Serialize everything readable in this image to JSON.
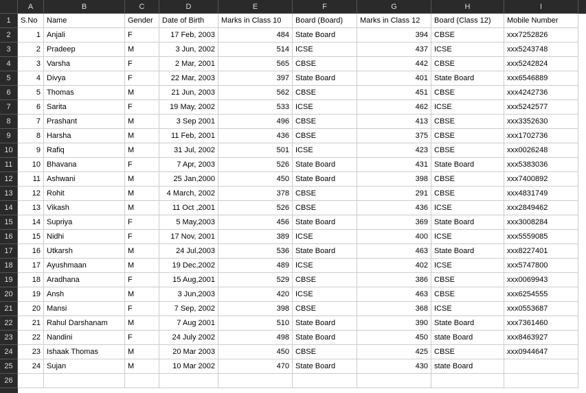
{
  "columns": [
    "A",
    "B",
    "C",
    "D",
    "E",
    "F",
    "G",
    "H",
    "I"
  ],
  "row_numbers": [
    1,
    2,
    3,
    4,
    5,
    6,
    7,
    8,
    9,
    10,
    11,
    12,
    13,
    14,
    15,
    16,
    17,
    18,
    19,
    20,
    21,
    22,
    23,
    24,
    25,
    26
  ],
  "headers": {
    "A": "S.No",
    "B": "Name",
    "C": "Gender",
    "D": "Date of Birth",
    "E": "Marks in Class 10",
    "F": "Board (Board)",
    "G": "Marks in Class 12",
    "H": "Board (Class 12)",
    "I": "Mobile Number"
  },
  "rows": [
    {
      "sno": 1,
      "name": "Anjali",
      "gender": "F",
      "dob": "17 Feb, 2003",
      "m10": 484,
      "b10": "State Board",
      "m12": 394,
      "b12": "CBSE",
      "mobile": "xxx7252826"
    },
    {
      "sno": 2,
      "name": "Pradeep",
      "gender": "M",
      "dob": "3 Jun, 2002",
      "m10": 514,
      "b10": "ICSE",
      "m12": 437,
      "b12": "ICSE",
      "mobile": "xxx5243748"
    },
    {
      "sno": 3,
      "name": "Varsha",
      "gender": "F",
      "dob": "2 Mar, 2001",
      "m10": 565,
      "b10": "CBSE",
      "m12": 442,
      "b12": "CBSE",
      "mobile": "xxx5242824"
    },
    {
      "sno": 4,
      "name": "Divya",
      "gender": "F",
      "dob": "22 Mar, 2003",
      "m10": 397,
      "b10": "State Board",
      "m12": 401,
      "b12": "State Board",
      "mobile": "xxx6546889"
    },
    {
      "sno": 5,
      "name": "Thomas",
      "gender": "M",
      "dob": "21 Jun, 2003",
      "m10": 562,
      "b10": "CBSE",
      "m12": 451,
      "b12": "CBSE",
      "mobile": "xxx4242736"
    },
    {
      "sno": 6,
      "name": "Sarita",
      "gender": "F",
      "dob": "19 May, 2002",
      "m10": 533,
      "b10": "ICSE",
      "m12": 462,
      "b12": "ICSE",
      "mobile": "xxx5242577"
    },
    {
      "sno": 7,
      "name": "Prashant",
      "gender": "M",
      "dob": "3 Sep 2001",
      "m10": 496,
      "b10": "CBSE",
      "m12": 413,
      "b12": "CBSE",
      "mobile": "xxx3352630"
    },
    {
      "sno": 8,
      "name": "Harsha",
      "gender": "M",
      "dob": "11 Feb, 2001",
      "m10": 436,
      "b10": "CBSE",
      "m12": 375,
      "b12": "CBSE",
      "mobile": "xxx1702736"
    },
    {
      "sno": 9,
      "name": "Rafiq",
      "gender": "M",
      "dob": "31 Jul, 2002",
      "m10": 501,
      "b10": "ICSE",
      "m12": 423,
      "b12": "CBSE",
      "mobile": "xxx0026248"
    },
    {
      "sno": 10,
      "name": "Bhavana",
      "gender": "F",
      "dob": "7 Apr, 2003",
      "m10": 526,
      "b10": "State Board",
      "m12": 431,
      "b12": "State Board",
      "mobile": "xxx5383036"
    },
    {
      "sno": 11,
      "name": "Ashwani",
      "gender": "M",
      "dob": "25 Jan,2000",
      "m10": 450,
      "b10": "State Board",
      "m12": 398,
      "b12": "CBSE",
      "mobile": "xxx7400892"
    },
    {
      "sno": 12,
      "name": "Rohit",
      "gender": "M",
      "dob": "4 March, 2002",
      "m10": 378,
      "b10": "CBSE",
      "m12": 291,
      "b12": "CBSE",
      "mobile": "xxx4831749"
    },
    {
      "sno": 13,
      "name": "Vikash",
      "gender": "M",
      "dob": "11 Oct ,2001",
      "m10": 526,
      "b10": "CBSE",
      "m12": 436,
      "b12": "ICSE",
      "mobile": "xxx2849462"
    },
    {
      "sno": 14,
      "name": "Supriya",
      "gender": "F",
      "dob": "5 May,2003",
      "m10": 456,
      "b10": "State Board",
      "m12": 369,
      "b12": "State Board",
      "mobile": "xxx3008284"
    },
    {
      "sno": 15,
      "name": "Nidhi",
      "gender": "F",
      "dob": "17 Nov, 2001",
      "m10": 389,
      "b10": "ICSE",
      "m12": 400,
      "b12": "ICSE",
      "mobile": "xxx5559085"
    },
    {
      "sno": 16,
      "name": "Utkarsh",
      "gender": "M",
      "dob": "24 Jul,2003",
      "m10": 536,
      "b10": "State Board",
      "m12": 463,
      "b12": "State Board",
      "mobile": "xxx8227401"
    },
    {
      "sno": 17,
      "name": "Ayushmaan",
      "gender": "M",
      "dob": "19 Dec,2002",
      "m10": 489,
      "b10": "ICSE",
      "m12": 402,
      "b12": "ICSE",
      "mobile": "xxx5747800"
    },
    {
      "sno": 18,
      "name": "Aradhana",
      "gender": "F",
      "dob": "15 Aug,2001",
      "m10": 529,
      "b10": "CBSE",
      "m12": 386,
      "b12": "CBSE",
      "mobile": "xxx0069943"
    },
    {
      "sno": 19,
      "name": "Ansh",
      "gender": "M",
      "dob": "3 Jun,2003",
      "m10": 420,
      "b10": "ICSE",
      "m12": 463,
      "b12": "CBSE",
      "mobile": "xxx6254555"
    },
    {
      "sno": 20,
      "name": "Mansi",
      "gender": "F",
      "dob": "7 Sep, 2002",
      "m10": 398,
      "b10": "CBSE",
      "m12": 368,
      "b12": "ICSE",
      "mobile": "xxx0553687"
    },
    {
      "sno": 21,
      "name": "Rahul Darshanam",
      "gender": "M",
      "dob": "7 Aug 2001",
      "m10": 510,
      "b10": "State Board",
      "m12": 390,
      "b12": "State Board",
      "mobile": "xxx7361460"
    },
    {
      "sno": 22,
      "name": "Nandini",
      "gender": "F",
      "dob": "24 July 2002",
      "m10": 498,
      "b10": "State Board",
      "m12": 450,
      "b12": "state Board",
      "mobile": "xxx8463927"
    },
    {
      "sno": 23,
      "name": "Ishaak Thomas",
      "gender": "M",
      "dob": "20 Mar 2003",
      "m10": 450,
      "b10": "CBSE",
      "m12": 425,
      "b12": "CBSE",
      "mobile": "xxx0944647"
    },
    {
      "sno": 24,
      "name": "Sujan",
      "gender": "M",
      "dob": "10 Mar 2002",
      "m10": 470,
      "b10": "State Board",
      "m12": 430,
      "b12": "state Board",
      "mobile": ""
    }
  ]
}
